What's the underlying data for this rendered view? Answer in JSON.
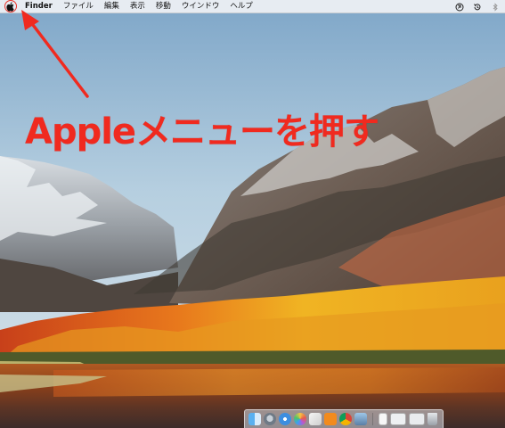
{
  "menubar": {
    "apple_icon": "apple-logo-icon",
    "items": [
      "Finder",
      "ファイル",
      "編集",
      "表示",
      "移動",
      "ウインドウ",
      "ヘルプ"
    ],
    "status_icons": [
      "time-machine-icon",
      "clock-history-icon",
      "bluetooth-icon"
    ]
  },
  "annotation": {
    "text": "Appleメニューを押す",
    "color": "#f02a1f"
  },
  "dock": {
    "icons": [
      "finder-icon",
      "launchpad-icon",
      "safari-icon",
      "photos-app-icon",
      "photos-icon",
      "ibooks-icon",
      "chrome-icon",
      "preview-icon",
      "documents-icon",
      "finder-window-icon",
      "downloads-icon",
      "trash-icon"
    ]
  }
}
